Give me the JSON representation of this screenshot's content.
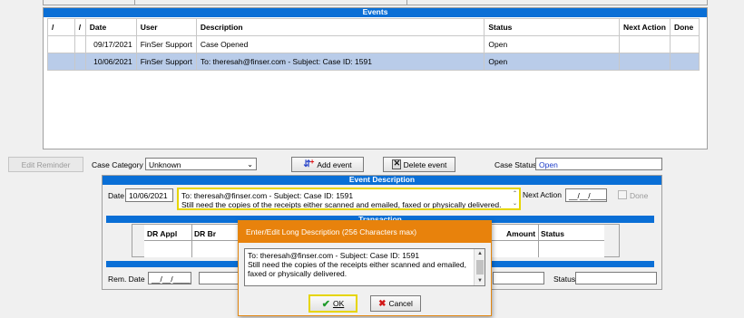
{
  "events": {
    "title": "Events",
    "columns": [
      "/",
      "/",
      "Date",
      "User",
      "Description",
      "Status",
      "Next Action",
      "Done"
    ],
    "rows": [
      {
        "date": "09/17/2021",
        "user": "FinSer Support",
        "description": "Case Opened",
        "status": "Open",
        "selected": false
      },
      {
        "date": "10/06/2021",
        "user": "FinSer Support",
        "description": "To: theresah@finser.com - Subject: Case ID: 1591",
        "status": "Open",
        "selected": true
      }
    ]
  },
  "toolbar": {
    "edit_reminder_label": "Edit Reminder",
    "case_category_label": "Case Category",
    "case_category_value": "Unknown",
    "add_event_label": "Add event",
    "delete_event_label": "Delete event",
    "case_status_label": "Case Status",
    "case_status_value": "Open"
  },
  "event_description": {
    "title": "Event Description",
    "date_label": "Date",
    "date_value": "10/06/2021",
    "description_line1": "To: theresah@finser.com - Subject: Case ID: 1591",
    "description_line2": "Still need the copies of the receipts either scanned and emailed, faxed or physically delivered.",
    "next_action_label": "Next Action",
    "next_action_value": "__/__/____",
    "done_label": "Done"
  },
  "transaction": {
    "title": "Transaction",
    "columns": [
      "DR Appl",
      "DR Br",
      "Amount",
      "Status"
    ]
  },
  "reminder": {
    "rem_date_label": "Rem. Date",
    "rem_date_value": "__/__/____",
    "status_label": "Status"
  },
  "dialog": {
    "title": "Enter/Edit Long Description (256 Characters max)",
    "line1": "To: theresah@finser.com - Subject: Case ID: 1591",
    "line2": "Still need the copies of the receipts either scanned and emailed,",
    "line3": "faxed or physically delivered.",
    "ok_label": "OK",
    "cancel_label": "Cancel"
  },
  "colors": {
    "section_bar": "#0a6fd6",
    "dialog_title": "#e8820c",
    "selected_row": "#b9cce9",
    "focus_border": "#e6d500"
  }
}
